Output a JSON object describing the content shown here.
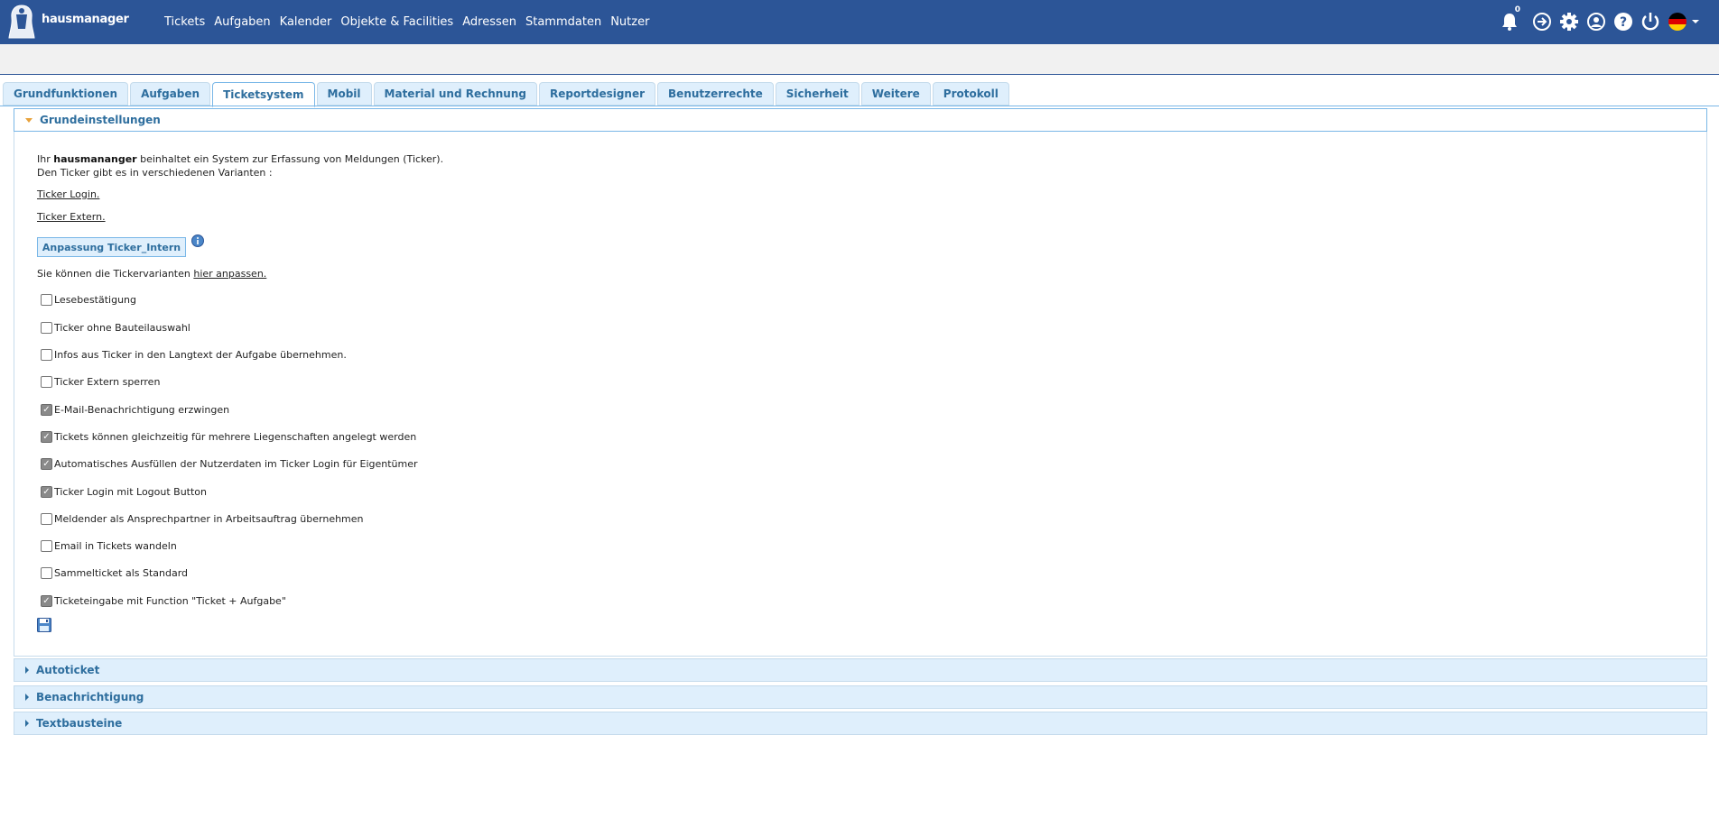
{
  "brand": {
    "logo_text": "hausmanager"
  },
  "nav": [
    "Tickets",
    "Aufgaben",
    "Kalender",
    "Objekte & Facilities",
    "Adressen",
    "Stammdaten",
    "Nutzer"
  ],
  "notifications": {
    "count": "0"
  },
  "tabs": [
    {
      "label": "Grundfunktionen",
      "active": false
    },
    {
      "label": "Aufgaben",
      "active": false
    },
    {
      "label": "Ticketsystem",
      "active": true
    },
    {
      "label": "Mobil",
      "active": false
    },
    {
      "label": "Material und Rechnung",
      "active": false
    },
    {
      "label": "Reportdesigner",
      "active": false
    },
    {
      "label": "Benutzerrechte",
      "active": false
    },
    {
      "label": "Sicherheit",
      "active": false
    },
    {
      "label": "Weitere",
      "active": false
    },
    {
      "label": "Protokoll",
      "active": false
    }
  ],
  "section_main": {
    "title": "Grundeinstellungen",
    "intro_prefix": "Ihr ",
    "intro_brand": "hausmananger",
    "intro_suffix": " beinhaltet ein System zur Erfassung von Meldungen (Ticker).",
    "intro_line2": "Den Ticker gibt es in verschiedenen Varianten :",
    "link_login": "Ticker Login.",
    "link_extern": "Ticker Extern.",
    "button_label": "Anpassung Ticker_Intern",
    "variants_prefix": "Sie können die Tickervarianten ",
    "variants_link": "hier anpassen.",
    "checkboxes": [
      {
        "label": "Lesebestätigung",
        "checked": false
      },
      {
        "label": "Ticker ohne Bauteilauswahl",
        "checked": false
      },
      {
        "label": "Infos aus Ticker in den Langtext der Aufgabe übernehmen.",
        "checked": false
      },
      {
        "label": "Ticker Extern sperren",
        "checked": false
      },
      {
        "label": "E-Mail-Benachrichtigung erzwingen",
        "checked": true
      },
      {
        "label": "Tickets können gleichzeitig für mehrere Liegenschaften angelegt werden",
        "checked": true
      },
      {
        "label": "Automatisches Ausfüllen der Nutzerdaten im Ticker Login für Eigentümer",
        "checked": true
      },
      {
        "label": "Ticker Login mit Logout Button",
        "checked": true
      },
      {
        "label": "Meldender als Ansprechpartner in Arbeitsauftrag übernehmen",
        "checked": false
      },
      {
        "label": "Email in Tickets wandeln",
        "checked": false
      },
      {
        "label": "Sammelticket als Standard",
        "checked": false
      },
      {
        "label": "Ticketeingabe mit Function \"Ticket + Aufgabe\"",
        "checked": true
      }
    ]
  },
  "sections_collapsed": [
    "Autoticket",
    "Benachrichtigung",
    "Textbausteine"
  ],
  "colors": {
    "navbar": "#2c5597",
    "accent": "#2e6e9e",
    "tab_bg": "#dfeffc"
  }
}
